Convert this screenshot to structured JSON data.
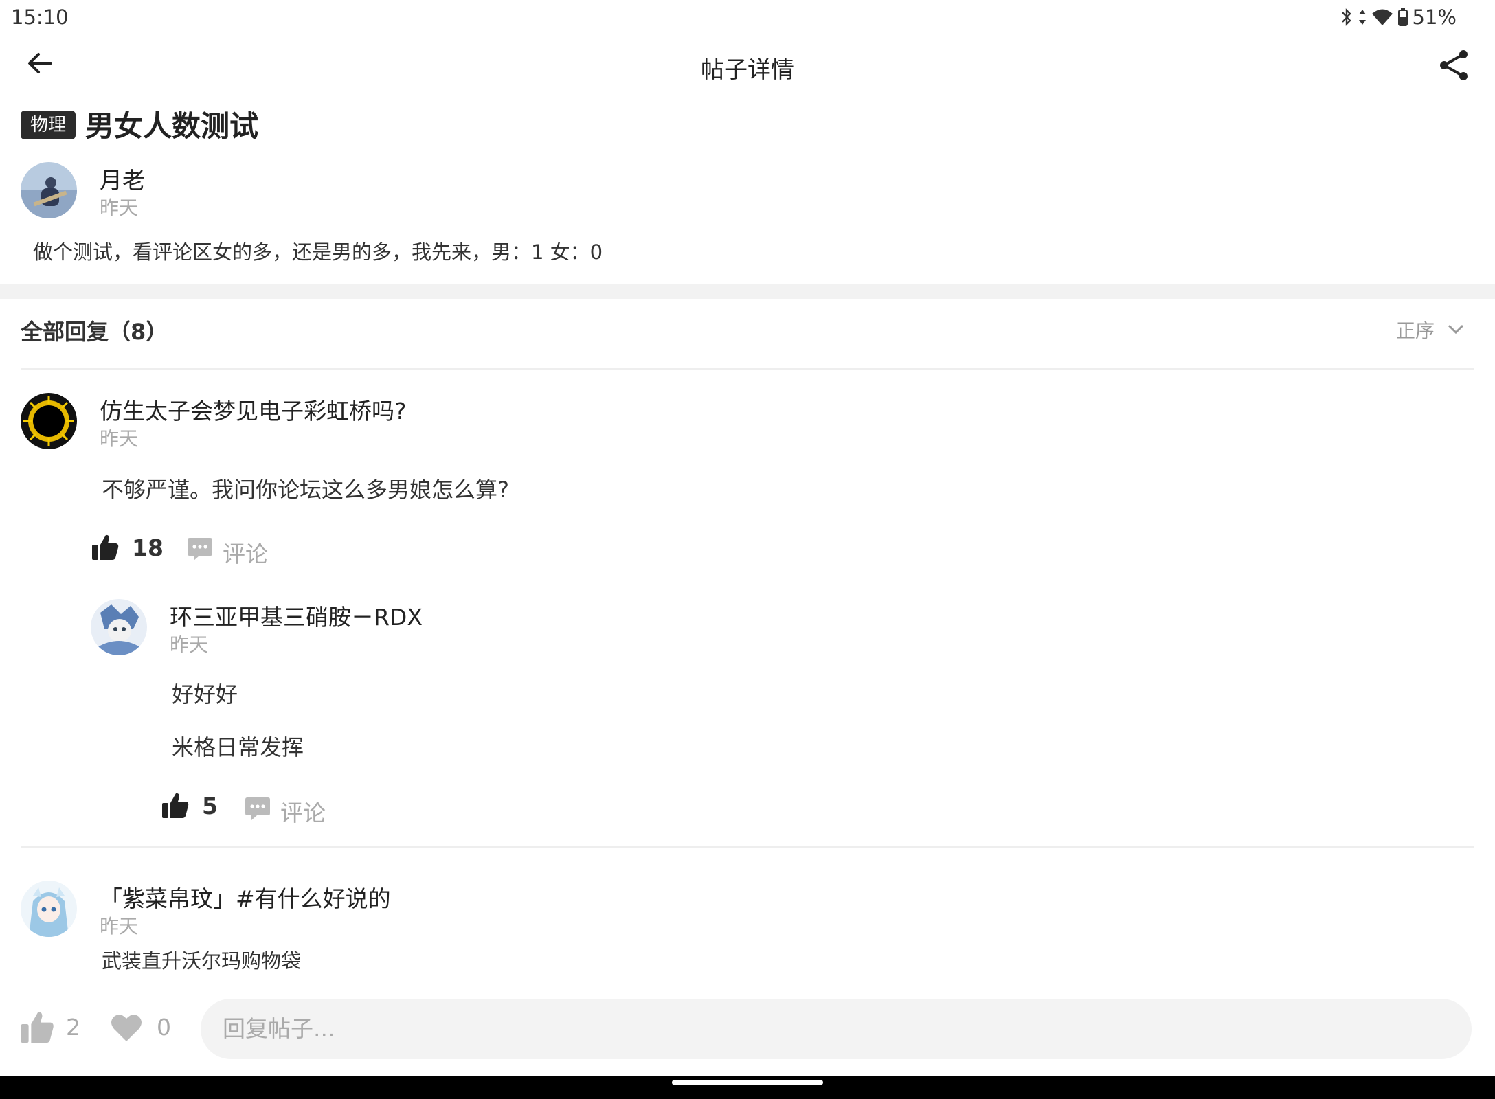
{
  "status_bar": {
    "time": "15:10",
    "battery": "51%"
  },
  "header": {
    "title": "帖子详情"
  },
  "post": {
    "tag": "物理",
    "title": "男女人数测试",
    "author": "月老",
    "time": "昨天",
    "body": "做个测试，看评论区女的多，还是男的多，我先来，男：1 女：0"
  },
  "replies_section": {
    "heading": "全部回复（8）",
    "sort_label": "正序"
  },
  "replies": [
    {
      "author": "仿生太子会梦见电子彩虹桥吗?",
      "time": "昨天",
      "text": "不够严谨。我问你论坛这么多男娘怎么算?",
      "likes": "18",
      "comment_label": "评论",
      "sub_reply": {
        "author": "环三亚甲基三硝胺－RDX",
        "time": "昨天",
        "lines": [
          "好好好",
          "米格日常发挥"
        ],
        "likes": "5",
        "comment_label": "评论"
      }
    },
    {
      "author": "「紫菜帛玟」#有什么好说的",
      "time": "昨天",
      "text": "武装直升沃尔玛购物袋"
    }
  ],
  "bottom_bar": {
    "like_count": "2",
    "favorite_count": "0",
    "reply_placeholder": "回复帖子..."
  },
  "colors": {
    "tag_bg": "#2b2b2b",
    "secondary_text": "#aaaaaa",
    "divider": "#f2f2f2"
  }
}
